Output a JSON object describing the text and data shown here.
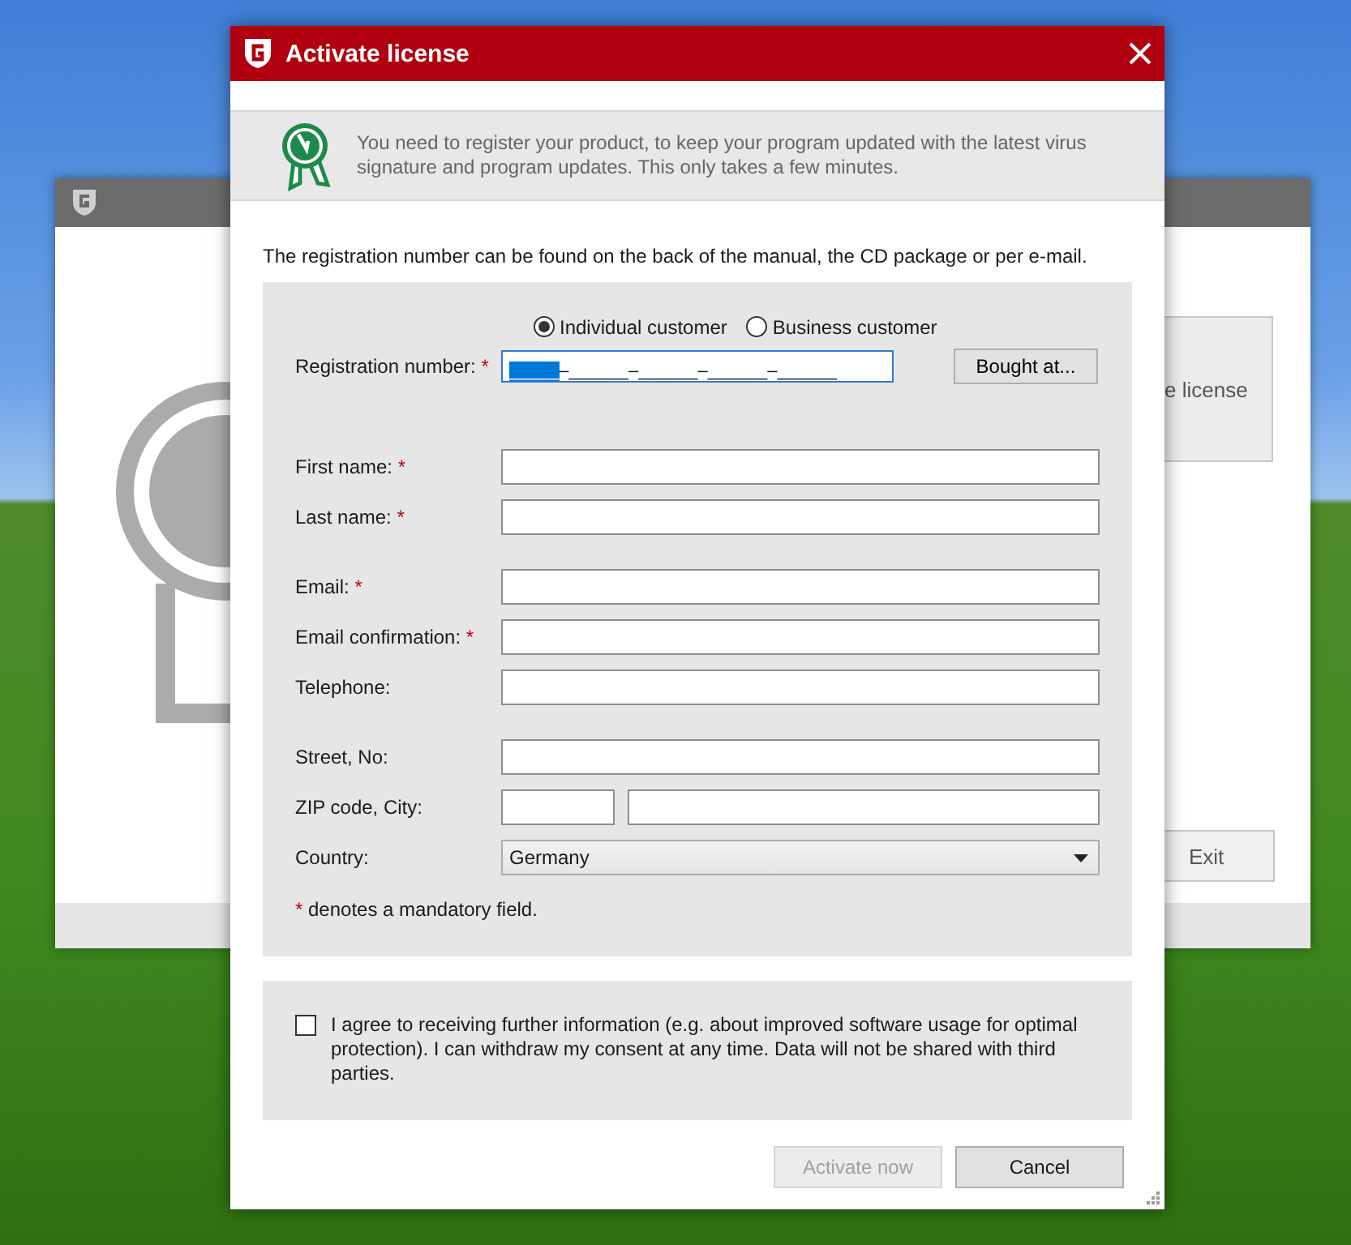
{
  "background_window": {
    "license_button": "e license",
    "exit_button": "Exit"
  },
  "dialog": {
    "title": "Activate license",
    "banner": "You need to register your product, to keep your program updated with the latest virus signature and program updates. This only takes a few minutes.",
    "hint": "The registration number can be found on the back of the manual, the CD package or per e-mail.",
    "customer_types": [
      {
        "label": "Individual customer",
        "selected": true
      },
      {
        "label": "Business customer",
        "selected": false
      }
    ],
    "required_mark": "*",
    "registration": {
      "label": "Registration number:",
      "required": true,
      "separator": "–",
      "segments": [
        {
          "text": "_____",
          "selected": true
        },
        {
          "text": "______",
          "selected": false
        },
        {
          "text": "______",
          "selected": false
        },
        {
          "text": "______",
          "selected": false
        },
        {
          "text": "______",
          "selected": false
        }
      ]
    },
    "bought_button": "Bought at...",
    "field_groups": [
      [
        {
          "kind": "text",
          "label": "First name:",
          "required": true
        },
        {
          "kind": "text",
          "label": "Last name:",
          "required": true
        }
      ],
      [
        {
          "kind": "text",
          "label": "Email:",
          "required": true
        },
        {
          "kind": "text",
          "label": "Email confirmation:",
          "required": true
        },
        {
          "kind": "text",
          "label": "Telephone:",
          "required": false
        }
      ],
      [
        {
          "kind": "text",
          "label": "Street, No:",
          "required": false
        },
        {
          "kind": "pair",
          "label": "ZIP code, City:",
          "required": false
        },
        {
          "kind": "select",
          "label": "Country:",
          "required": false,
          "value": "Germany"
        }
      ]
    ],
    "required_note": "denotes a mandatory field.",
    "consent": {
      "checked": false,
      "text": "I agree to receiving further information (e.g. about improved software usage for optimal protection). I can withdraw my consent at any time. Data will not be shared with third parties."
    },
    "buttons": [
      {
        "label": "Activate now",
        "disabled": true
      },
      {
        "label": "Cancel",
        "disabled": false
      }
    ]
  }
}
